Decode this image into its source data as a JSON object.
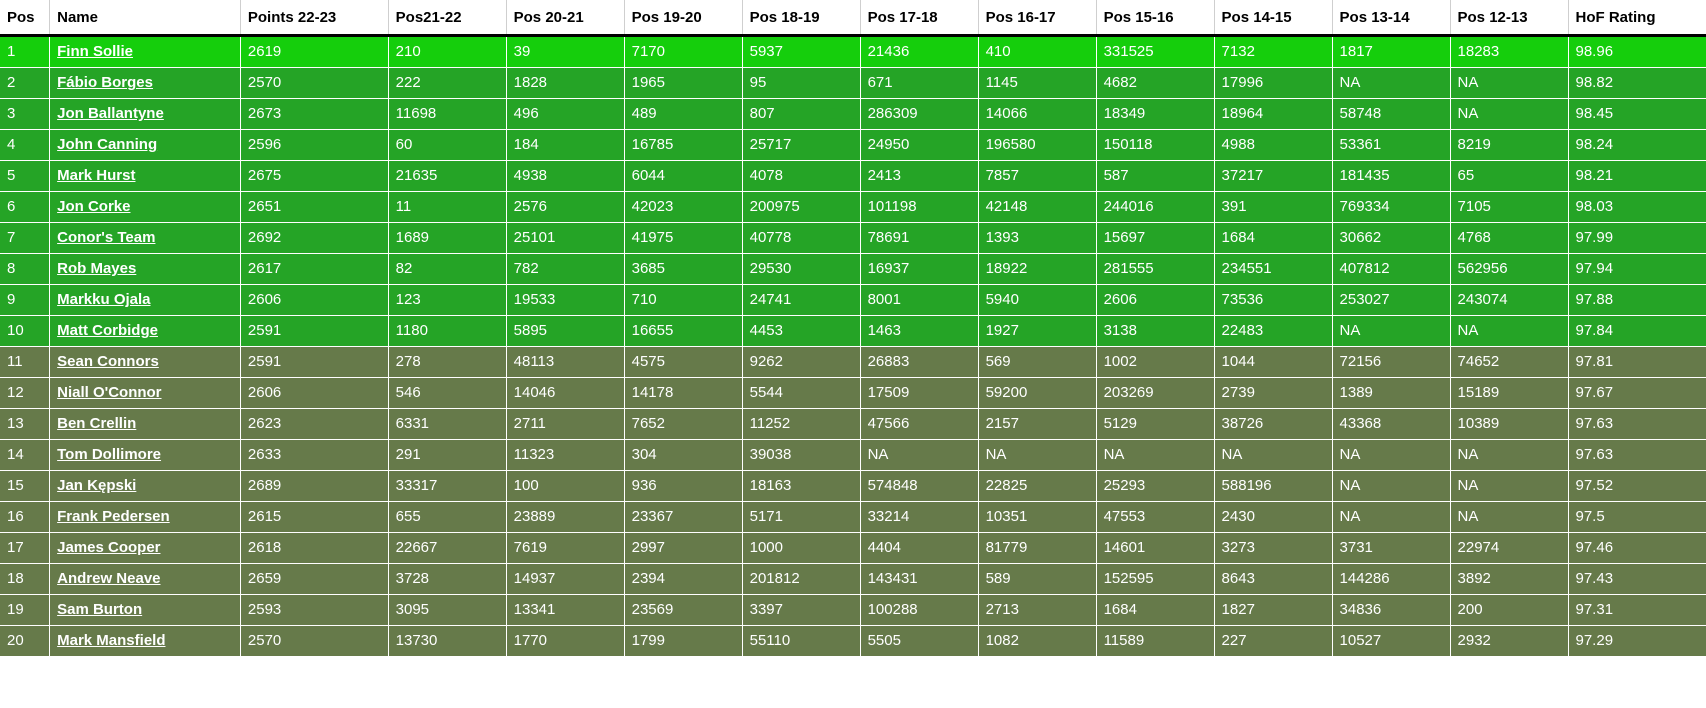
{
  "table": {
    "columns": [
      {
        "key": "pos",
        "label": "Pos"
      },
      {
        "key": "name",
        "label": "Name"
      },
      {
        "key": "points",
        "label": "Points 22-23"
      },
      {
        "key": "pos21_22",
        "label": "Pos21-22"
      },
      {
        "key": "pos20_21",
        "label": "Pos 20-21"
      },
      {
        "key": "pos19_20",
        "label": "Pos 19-20"
      },
      {
        "key": "pos18_19",
        "label": "Pos 18-19"
      },
      {
        "key": "pos17_18",
        "label": "Pos 17-18"
      },
      {
        "key": "pos16_17",
        "label": "Pos 16-17"
      },
      {
        "key": "pos15_16",
        "label": "Pos 15-16"
      },
      {
        "key": "pos14_15",
        "label": "Pos 14-15"
      },
      {
        "key": "pos13_14",
        "label": "Pos 13-14"
      },
      {
        "key": "pos12_13",
        "label": "Pos 12-13"
      },
      {
        "key": "hof",
        "label": "HoF Rating"
      }
    ],
    "colors": {
      "tier_top": "#15CE0C",
      "tier_bright": "#25A426",
      "tier_muted": "#667A4A",
      "header_bg": "#FFFFFF",
      "header_text": "#000000",
      "cell_text": "#FFFFFF"
    },
    "rows": [
      {
        "tier": "tier-top",
        "pos": "1",
        "name": "Finn Sollie",
        "points": "2619",
        "pos21_22": "210",
        "pos20_21": "39",
        "pos19_20": "7170",
        "pos18_19": "5937",
        "pos17_18": "21436",
        "pos16_17": "410",
        "pos15_16": "331525",
        "pos14_15": "7132",
        "pos13_14": "1817",
        "pos12_13": "18283",
        "hof": "98.96"
      },
      {
        "tier": "tier-bright",
        "pos": "2",
        "name": "Fábio Borges",
        "points": "2570",
        "pos21_22": "222",
        "pos20_21": "1828",
        "pos19_20": "1965",
        "pos18_19": "95",
        "pos17_18": "671",
        "pos16_17": "1145",
        "pos15_16": "4682",
        "pos14_15": "17996",
        "pos13_14": "NA",
        "pos12_13": "NA",
        "hof": "98.82"
      },
      {
        "tier": "tier-bright",
        "pos": "3",
        "name": "Jon Ballantyne",
        "points": "2673",
        "pos21_22": "11698",
        "pos20_21": "496",
        "pos19_20": "489",
        "pos18_19": "807",
        "pos17_18": "286309",
        "pos16_17": "14066",
        "pos15_16": "18349",
        "pos14_15": "18964",
        "pos13_14": "58748",
        "pos12_13": "NA",
        "hof": "98.45"
      },
      {
        "tier": "tier-bright",
        "pos": "4",
        "name": "John Canning",
        "points": "2596",
        "pos21_22": "60",
        "pos20_21": "184",
        "pos19_20": "16785",
        "pos18_19": "25717",
        "pos17_18": "24950",
        "pos16_17": "196580",
        "pos15_16": "150118",
        "pos14_15": "4988",
        "pos13_14": "53361",
        "pos12_13": "8219",
        "hof": "98.24"
      },
      {
        "tier": "tier-bright",
        "pos": "5",
        "name": "Mark Hurst",
        "points": "2675",
        "pos21_22": "21635",
        "pos20_21": "4938",
        "pos19_20": "6044",
        "pos18_19": "4078",
        "pos17_18": "2413",
        "pos16_17": "7857",
        "pos15_16": "587",
        "pos14_15": "37217",
        "pos13_14": "181435",
        "pos12_13": "65",
        "hof": "98.21"
      },
      {
        "tier": "tier-bright",
        "pos": "6",
        "name": "Jon Corke",
        "points": "2651",
        "pos21_22": "11",
        "pos20_21": "2576",
        "pos19_20": "42023",
        "pos18_19": "200975",
        "pos17_18": "101198",
        "pos16_17": "42148",
        "pos15_16": "244016",
        "pos14_15": "391",
        "pos13_14": "769334",
        "pos12_13": "7105",
        "hof": "98.03"
      },
      {
        "tier": "tier-bright",
        "pos": "7",
        "name": "Conor's Team",
        "points": "2692",
        "pos21_22": "1689",
        "pos20_21": "25101",
        "pos19_20": "41975",
        "pos18_19": "40778",
        "pos17_18": "78691",
        "pos16_17": "1393",
        "pos15_16": "15697",
        "pos14_15": "1684",
        "pos13_14": "30662",
        "pos12_13": "4768",
        "hof": "97.99"
      },
      {
        "tier": "tier-bright",
        "pos": "8",
        "name": "Rob Mayes",
        "points": "2617",
        "pos21_22": "82",
        "pos20_21": "782",
        "pos19_20": "3685",
        "pos18_19": "29530",
        "pos17_18": "16937",
        "pos16_17": "18922",
        "pos15_16": "281555",
        "pos14_15": "234551",
        "pos13_14": "407812",
        "pos12_13": "562956",
        "hof": "97.94"
      },
      {
        "tier": "tier-bright",
        "pos": "9",
        "name": "Markku Ojala",
        "points": "2606",
        "pos21_22": "123",
        "pos20_21": "19533",
        "pos19_20": "710",
        "pos18_19": "24741",
        "pos17_18": "8001",
        "pos16_17": "5940",
        "pos15_16": "2606",
        "pos14_15": "73536",
        "pos13_14": "253027",
        "pos12_13": "243074",
        "hof": "97.88"
      },
      {
        "tier": "tier-bright",
        "pos": "10",
        "name": "Matt Corbidge",
        "points": "2591",
        "pos21_22": "1180",
        "pos20_21": "5895",
        "pos19_20": "16655",
        "pos18_19": "4453",
        "pos17_18": "1463",
        "pos16_17": "1927",
        "pos15_16": "3138",
        "pos14_15": "22483",
        "pos13_14": "NA",
        "pos12_13": "NA",
        "hof": "97.84"
      },
      {
        "tier": "tier-muted",
        "pos": "11",
        "name": "Sean Connors",
        "points": "2591",
        "pos21_22": "278",
        "pos20_21": "48113",
        "pos19_20": "4575",
        "pos18_19": "9262",
        "pos17_18": "26883",
        "pos16_17": "569",
        "pos15_16": "1002",
        "pos14_15": "1044",
        "pos13_14": "72156",
        "pos12_13": "74652",
        "hof": "97.81"
      },
      {
        "tier": "tier-muted",
        "pos": "12",
        "name": "Niall O'Connor",
        "points": "2606",
        "pos21_22": "546",
        "pos20_21": "14046",
        "pos19_20": "14178",
        "pos18_19": "5544",
        "pos17_18": "17509",
        "pos16_17": "59200",
        "pos15_16": "203269",
        "pos14_15": "2739",
        "pos13_14": "1389",
        "pos12_13": "15189",
        "hof": "97.67"
      },
      {
        "tier": "tier-muted",
        "pos": "13",
        "name": "Ben Crellin",
        "points": "2623",
        "pos21_22": "6331",
        "pos20_21": "2711",
        "pos19_20": "7652",
        "pos18_19": "11252",
        "pos17_18": "47566",
        "pos16_17": "2157",
        "pos15_16": "5129",
        "pos14_15": "38726",
        "pos13_14": "43368",
        "pos12_13": "10389",
        "hof": "97.63"
      },
      {
        "tier": "tier-muted",
        "pos": "14",
        "name": "Tom Dollimore",
        "points": "2633",
        "pos21_22": "291",
        "pos20_21": "11323",
        "pos19_20": "304",
        "pos18_19": "39038",
        "pos17_18": "NA",
        "pos16_17": "NA",
        "pos15_16": "NA",
        "pos14_15": "NA",
        "pos13_14": "NA",
        "pos12_13": "NA",
        "hof": "97.63"
      },
      {
        "tier": "tier-muted",
        "pos": "15",
        "name": "Jan Kępski",
        "points": "2689",
        "pos21_22": "33317",
        "pos20_21": "100",
        "pos19_20": "936",
        "pos18_19": "18163",
        "pos17_18": "574848",
        "pos16_17": "22825",
        "pos15_16": "25293",
        "pos14_15": "588196",
        "pos13_14": "NA",
        "pos12_13": "NA",
        "hof": "97.52"
      },
      {
        "tier": "tier-muted",
        "pos": "16",
        "name": "Frank Pedersen",
        "points": "2615",
        "pos21_22": "655",
        "pos20_21": "23889",
        "pos19_20": "23367",
        "pos18_19": "5171",
        "pos17_18": "33214",
        "pos16_17": "10351",
        "pos15_16": "47553",
        "pos14_15": "2430",
        "pos13_14": "NA",
        "pos12_13": "NA",
        "hof": "97.5"
      },
      {
        "tier": "tier-muted",
        "pos": "17",
        "name": "James Cooper",
        "points": "2618",
        "pos21_22": "22667",
        "pos20_21": "7619",
        "pos19_20": "2997",
        "pos18_19": "1000",
        "pos17_18": "4404",
        "pos16_17": "81779",
        "pos15_16": "14601",
        "pos14_15": "3273",
        "pos13_14": "3731",
        "pos12_13": "22974",
        "hof": "97.46"
      },
      {
        "tier": "tier-muted",
        "pos": "18",
        "name": "Andrew Neave",
        "points": "2659",
        "pos21_22": "3728",
        "pos20_21": "14937",
        "pos19_20": "2394",
        "pos18_19": "201812",
        "pos17_18": "143431",
        "pos16_17": "589",
        "pos15_16": "152595",
        "pos14_15": "8643",
        "pos13_14": "144286",
        "pos12_13": "3892",
        "hof": "97.43"
      },
      {
        "tier": "tier-muted",
        "pos": "19",
        "name": "Sam Burton",
        "points": "2593",
        "pos21_22": "3095",
        "pos20_21": "13341",
        "pos19_20": "23569",
        "pos18_19": "3397",
        "pos17_18": "100288",
        "pos16_17": "2713",
        "pos15_16": "1684",
        "pos14_15": "1827",
        "pos13_14": "34836",
        "pos12_13": "200",
        "hof": "97.31"
      },
      {
        "tier": "tier-muted",
        "pos": "20",
        "name": "Mark Mansfield",
        "points": "2570",
        "pos21_22": "13730",
        "pos20_21": "1770",
        "pos19_20": "1799",
        "pos18_19": "55110",
        "pos17_18": "5505",
        "pos16_17": "1082",
        "pos15_16": "11589",
        "pos14_15": "227",
        "pos13_14": "10527",
        "pos12_13": "2932",
        "hof": "97.29"
      }
    ]
  }
}
